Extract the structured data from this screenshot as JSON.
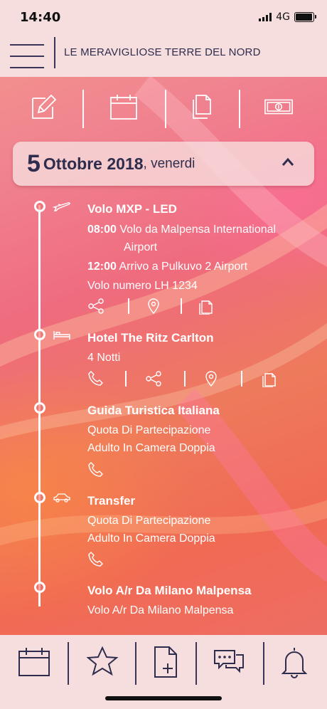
{
  "status_bar": {
    "time": "14:40",
    "network": "4G"
  },
  "header": {
    "title": "LE MERAVIGLIOSE TERRE DEL NORD"
  },
  "toolbar": {
    "icons": [
      "edit-icon",
      "calendar-icon",
      "documents-icon",
      "money-icon"
    ]
  },
  "date_card": {
    "day": "5",
    "month_year": "Ottobre 2018",
    "weekday": ", venerdi"
  },
  "timeline": [
    {
      "icon": "plane-icon",
      "title": "Volo MXP - LED",
      "lines": [
        {
          "time": "08:00",
          "text": "Volo da Malpensa International",
          "cont": "Airport"
        },
        {
          "time": "12:00",
          "text": "Arrivo a Pulkuvo 2 Airport"
        },
        {
          "text": "Volo numero LH 1234"
        }
      ],
      "actions": [
        "share-icon",
        "location-icon",
        "document-icon"
      ]
    },
    {
      "icon": "bed-icon",
      "title": "Hotel The Ritz Carlton",
      "lines": [
        {
          "text": "4 Notti"
        }
      ],
      "actions": [
        "phone-icon",
        "share-icon",
        "location-icon",
        "document-icon"
      ]
    },
    {
      "icon": "",
      "title": "Guida Turistica Italiana",
      "lines": [
        {
          "text": "Quota Di Partecipazione"
        },
        {
          "text": "Adulto In Camera Doppia"
        }
      ],
      "actions": [
        "phone-icon"
      ]
    },
    {
      "icon": "car-icon",
      "title": "Transfer",
      "lines": [
        {
          "text": "Quota Di Partecipazione"
        },
        {
          "text": "Adulto In Camera Doppia"
        }
      ],
      "actions": [
        "phone-icon"
      ]
    },
    {
      "icon": "",
      "title": "Volo A/r Da Milano Malpensa",
      "lines": [
        {
          "text": "Volo A/r Da Milano Malpensa"
        }
      ],
      "actions": []
    }
  ],
  "bottom_nav": [
    "calendar-icon",
    "star-icon",
    "add-document-icon",
    "chat-icon",
    "bell-icon"
  ],
  "colors": {
    "bar_bg": "#f7dede",
    "accent_dark": "#2f2d4e"
  }
}
